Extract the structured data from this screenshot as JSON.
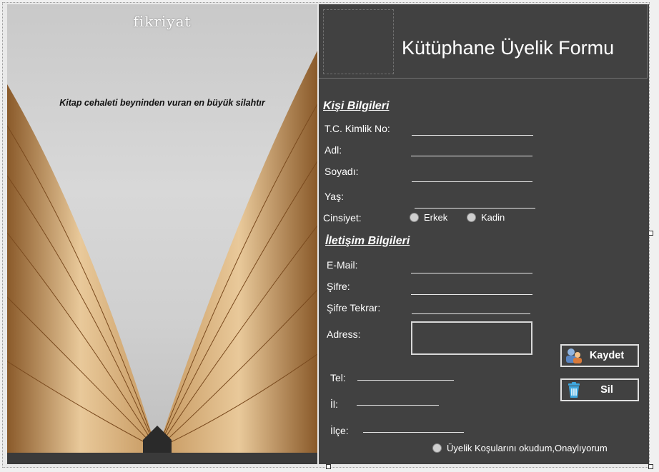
{
  "image_panel": {
    "brand": "fikriyat",
    "quote": "Kitap cehaleti beyninden vuran en büyük silahtır"
  },
  "form": {
    "title": "Kütüphane Üyelik Formu",
    "personal_section": "Kişi Bilgileri",
    "tc_label": "T.C. Kimlik No:",
    "name_label": "Adl:",
    "surname_label": "Soyadı:",
    "age_label": "Yaş:",
    "gender_label": "Cinsiyet:",
    "gender_options": [
      "Erkek",
      "Kadin"
    ],
    "contact_section": "İletişim Bilgileri",
    "email_label": "E-Mail:",
    "password_label": "Şifre:",
    "password_repeat_label": "Şifre Tekrar:",
    "address_label": "Adress:",
    "phone_label": "Tel:",
    "city_label": "İl:",
    "district_label": "İlçe:",
    "terms_label": "Üyelik Koşularını okudum,Onaylıyorum"
  },
  "buttons": {
    "save": "Kaydet",
    "delete": "Sil"
  },
  "colors": {
    "panel_bg": "#414141",
    "text": "#ffffff"
  }
}
